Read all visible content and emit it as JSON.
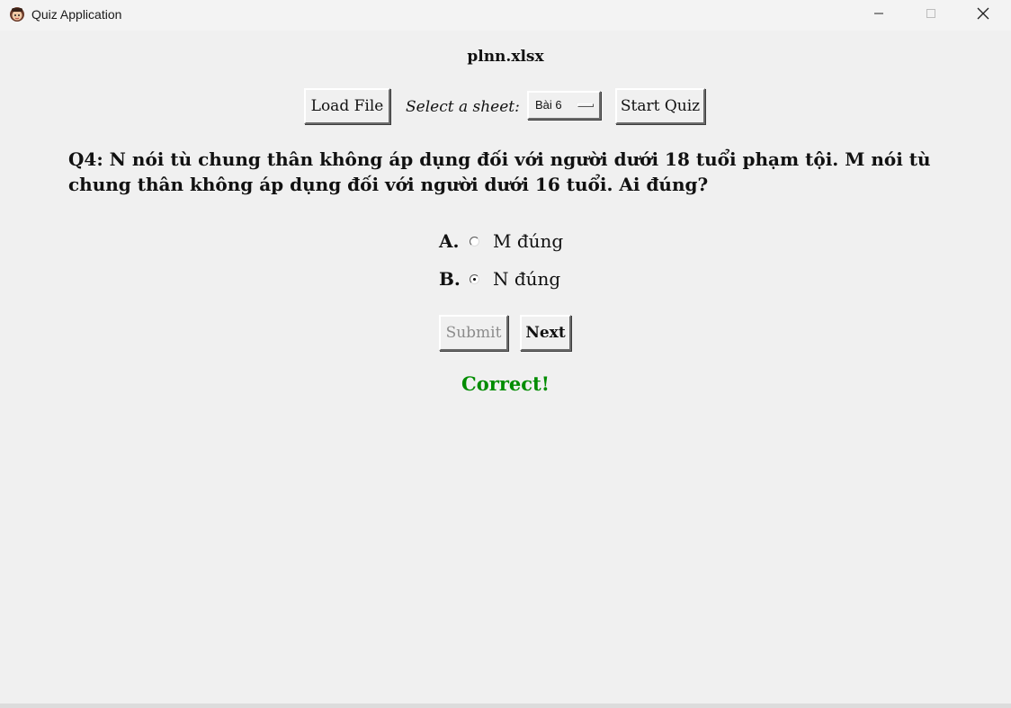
{
  "window": {
    "title": "Quiz Application",
    "icon": "app-icon",
    "controls": {
      "minimize": "minimize-icon",
      "maximize": "maximize-icon",
      "close": "close-icon"
    }
  },
  "header": {
    "filename": "plnn.xlsx"
  },
  "toolbar": {
    "load_label": "Load File",
    "sheet_label": "Select a sheet:",
    "sheet_value": "Bài 6",
    "start_label": "Start Quiz"
  },
  "question": {
    "text": "Q4: N nói tù chung thân không áp dụng đối với người dưới 18 tuổi phạm tội. M nói tù chung thân không áp dụng đối với người dưới 16 tuổi. Ai đúng?"
  },
  "options": [
    {
      "letter": "A.",
      "text": "M đúng",
      "selected": false
    },
    {
      "letter": "B.",
      "text": "N đúng",
      "selected": true
    }
  ],
  "actions": {
    "submit_label": "Submit",
    "submit_enabled": false,
    "next_label": "Next"
  },
  "feedback": {
    "text": "Correct!",
    "color": "#008c00"
  },
  "colors": {
    "background": "#f0f0f0",
    "disabled_text": "#8c8c8c"
  }
}
